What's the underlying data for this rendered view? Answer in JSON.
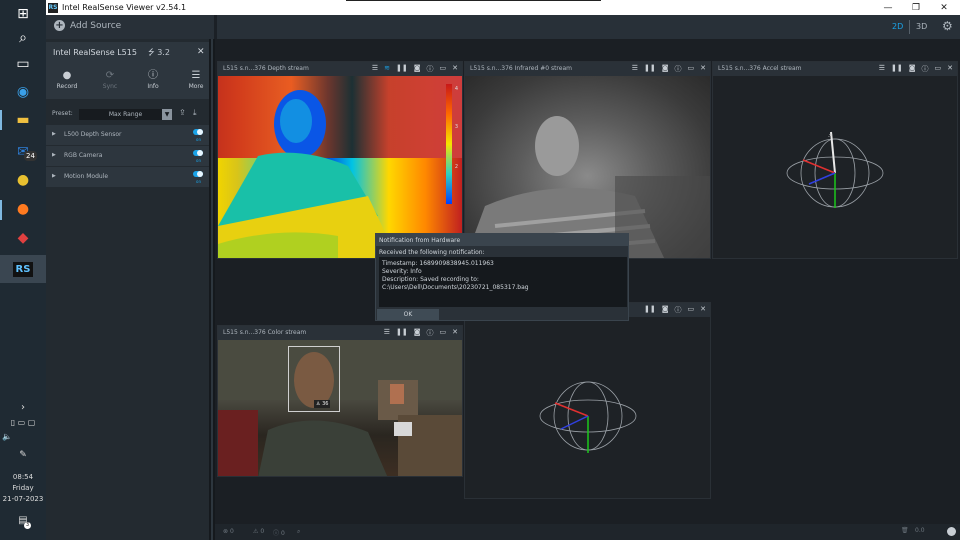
{
  "window": {
    "title": "Intel RealSense Viewer v2.54.1",
    "app_icon": "RS"
  },
  "taskbar": {
    "icons": [
      "windows-icon",
      "search-icon",
      "task-view-icon",
      "edge-icon",
      "file-explorer-icon",
      "mail-icon",
      "chrome-icon",
      "firefox-icon",
      "paint-icon",
      "realsense-icon"
    ],
    "mail_badge": "24",
    "realsense_label": "RS",
    "time": "08:54",
    "day": "Friday",
    "date": "21-07-2023",
    "notifications_badge": "3"
  },
  "topbar": {
    "add_source_label": "Add Source",
    "mode_2d": "2D",
    "mode_3d": "3D"
  },
  "device": {
    "name": "Intel RealSense L515",
    "usb": "3.2",
    "actions": [
      {
        "label": "Record",
        "icon": "record-icon",
        "enabled": true
      },
      {
        "label": "Sync",
        "icon": "sync-icon",
        "enabled": false
      },
      {
        "label": "Info",
        "icon": "info-icon",
        "enabled": true
      },
      {
        "label": "More",
        "icon": "menu-icon",
        "enabled": true
      }
    ],
    "preset_label": "Preset:",
    "preset_value": "Max Range",
    "sensors": [
      {
        "name": "L500 Depth Sensor",
        "state": "on"
      },
      {
        "name": "RGB Camera",
        "state": "on"
      },
      {
        "name": "Motion Module",
        "state": "on"
      }
    ]
  },
  "streams": {
    "depth": {
      "title": "L515 s.n...376 Depth stream",
      "scale_labels": [
        "4",
        "3",
        "2"
      ]
    },
    "infrared": {
      "title": "L515 s.n...376 Infrared #0 stream"
    },
    "accel": {
      "title": "L515 s.n...376 Accel stream",
      "axis_label": "-Y"
    },
    "color": {
      "title": "L515 s.n...376 Color stream",
      "face_label": "36"
    }
  },
  "notification": {
    "header": "Notification from Hardware",
    "subtitle": "Received the following notification:",
    "timestamp": "Timestamp: 1689909838945.011963",
    "severity": "Severity: Info",
    "description": "Description: Saved recording to:",
    "path": "C:\\Users\\Dell\\Documents\\20230721_085317.bag",
    "ok_label": "OK"
  },
  "statusbar": {
    "items": [
      "0",
      "0",
      "0"
    ],
    "right_text": "0.0"
  },
  "colors": {
    "accent": "#1aa3e8",
    "panel": "#232a30",
    "header": "#2a3138"
  }
}
